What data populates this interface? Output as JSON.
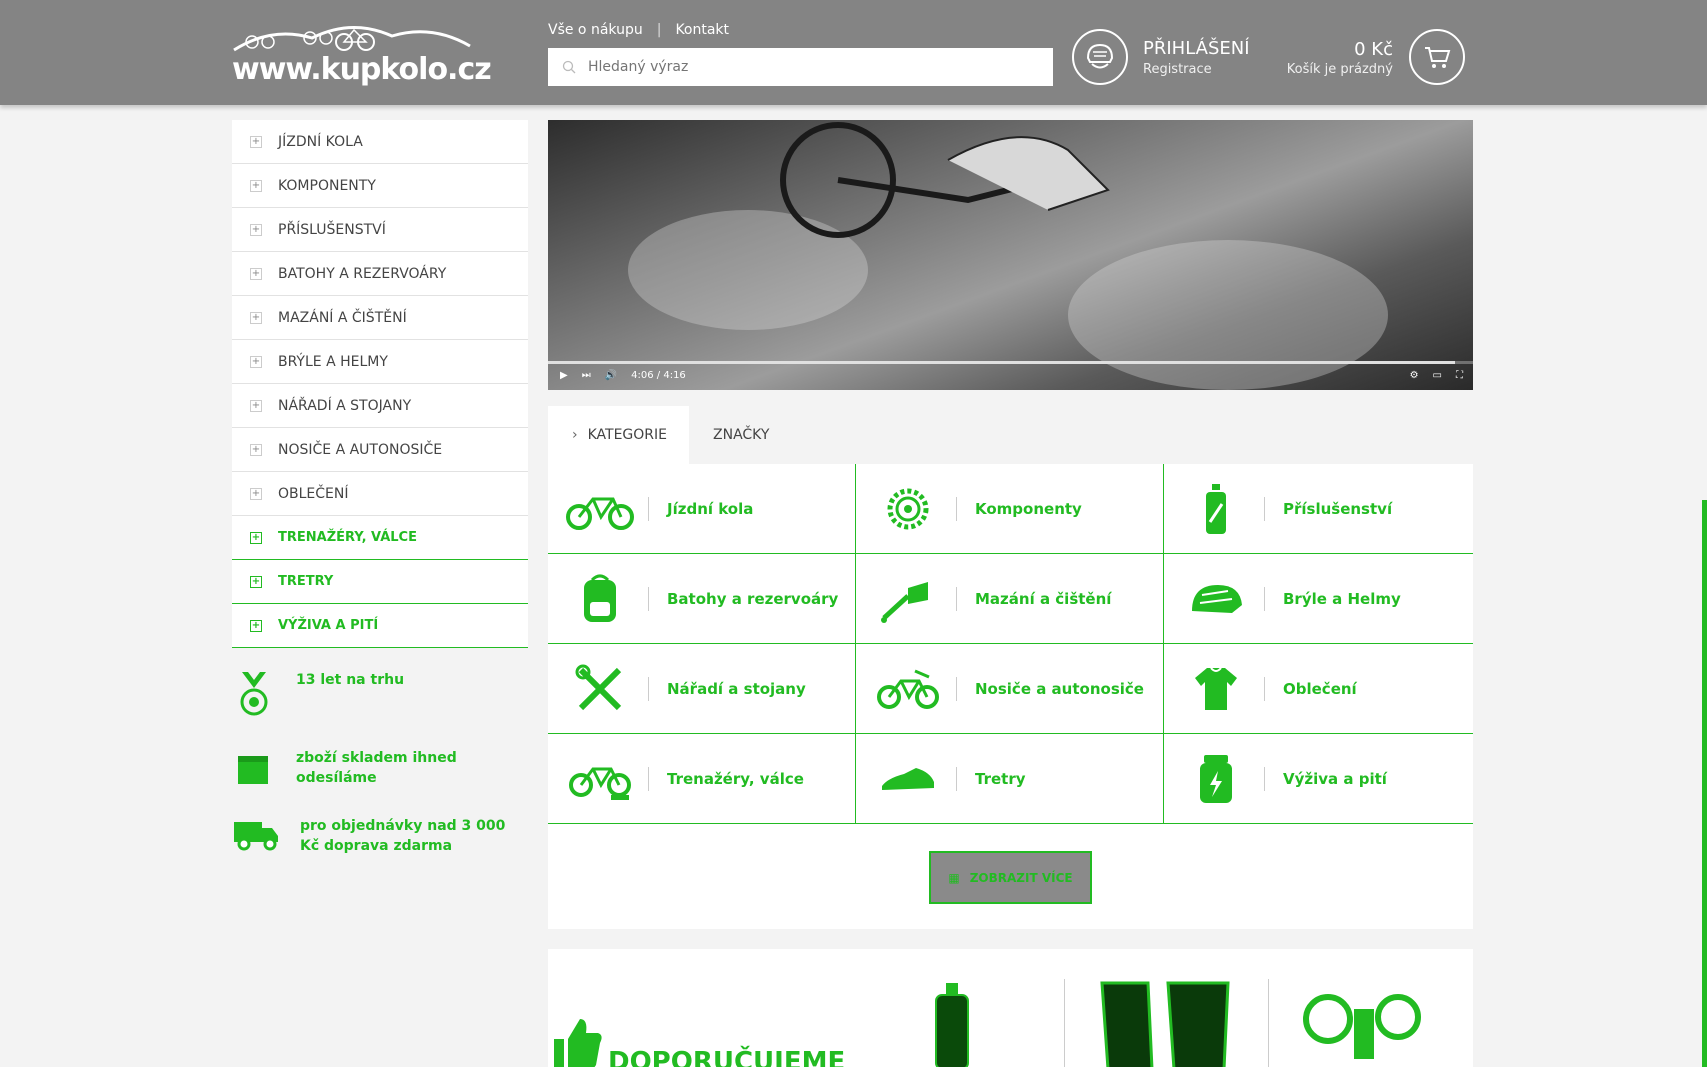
{
  "header": {
    "logo_text": "www.kupkolo.cz",
    "links": [
      "Vše o nákupu",
      "Kontakt"
    ],
    "link_separator": "|",
    "search_placeholder": "Hledaný výraz",
    "login_title": "PŘIHLÁŠENÍ",
    "register_label": "Registrace",
    "cart_price": "0 Kč",
    "cart_status": "Košík je prázdný"
  },
  "sidebar": {
    "items": [
      {
        "label": "JÍZDNÍ KOLA",
        "highlight": false
      },
      {
        "label": "KOMPONENTY",
        "highlight": false
      },
      {
        "label": "PŘÍSLUŠENSTVÍ",
        "highlight": false
      },
      {
        "label": "BATOHY A REZERVOÁRY",
        "highlight": false
      },
      {
        "label": "MAZÁNÍ A ČIŠTĚNÍ",
        "highlight": false
      },
      {
        "label": "BRÝLE A HELMY",
        "highlight": false
      },
      {
        "label": "NÁŘADÍ A STOJANY",
        "highlight": false
      },
      {
        "label": "NOSIČE A AUTONOSIČE",
        "highlight": false
      },
      {
        "label": "OBLEČENÍ",
        "highlight": false
      },
      {
        "label": "TRENAŽÉRY, VÁLCE",
        "highlight": true
      },
      {
        "label": "TRETRY",
        "highlight": true
      },
      {
        "label": "VÝŽIVA A PITÍ",
        "highlight": true
      }
    ]
  },
  "features": [
    {
      "icon": "medal-icon",
      "text": "13 let na trhu"
    },
    {
      "icon": "box-icon",
      "text": "zboží skladem ihned odesíláme"
    },
    {
      "icon": "truck-icon",
      "text": "pro objednávky nad 3 000 Kč doprava zdarma"
    }
  ],
  "video": {
    "time": "4:06 / 4:16",
    "progress": 0.98
  },
  "tabs": [
    {
      "label": "KATEGORIE",
      "active": true
    },
    {
      "label": "ZNAČKY",
      "active": false
    }
  ],
  "categories": [
    {
      "label": "Jízdní kola",
      "icon": "bike-icon"
    },
    {
      "label": "Komponenty",
      "icon": "chainring-icon"
    },
    {
      "label": "Příslušenství",
      "icon": "bottle-icon"
    },
    {
      "label": "Batohy a rezervoáry",
      "icon": "backpack-icon"
    },
    {
      "label": "Mazání a čištění",
      "icon": "oil-can-icon"
    },
    {
      "label": "Brýle a Helmy",
      "icon": "helmet-icon"
    },
    {
      "label": "Nářadí a stojany",
      "icon": "tools-icon"
    },
    {
      "label": "Nosiče a autonosiče",
      "icon": "bike-carrier-icon"
    },
    {
      "label": "Oblečení",
      "icon": "jersey-icon"
    },
    {
      "label": "Trenažéry, válce",
      "icon": "trainer-icon"
    },
    {
      "label": "Tretry",
      "icon": "shoe-icon"
    },
    {
      "label": "Výživa a pití",
      "icon": "supplement-icon"
    }
  ],
  "more_button": "ZOBRAZIT VÍCE",
  "recommend": {
    "title": "DOPORUČUJEME"
  },
  "colors": {
    "header_bg": "#848484",
    "accent_green": "#22bb22",
    "page_bg": "#f3f3f3"
  }
}
